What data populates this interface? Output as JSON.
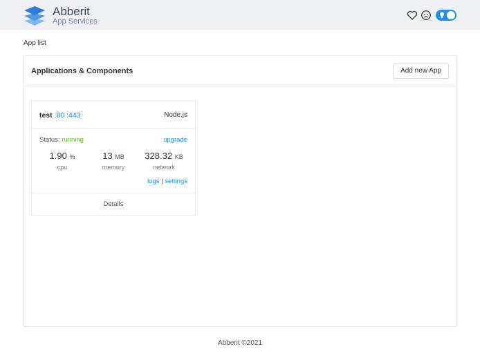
{
  "header": {
    "brand_name": "Abberit",
    "brand_sub": "App Services",
    "colors": {
      "accent": "#1f8ff0",
      "header_bg": "#eef0f4"
    },
    "icons": [
      "logo-stack-icon",
      "heart-icon",
      "frown-face-icon",
      "theme-toggle"
    ]
  },
  "breadcrumb": "App list",
  "panel": {
    "title": "Applications & Components",
    "add_button": "Add new App"
  },
  "apps": [
    {
      "name": "test",
      "ports": ":80 :443",
      "runtime": "Node.js",
      "status_label": "Status: ",
      "status": "running",
      "upgrade": "upgrade",
      "cpu": {
        "value": "1.90",
        "unit": "%",
        "label": "cpu"
      },
      "memory": {
        "value": "13",
        "unit": "MB",
        "label": "memory"
      },
      "network": {
        "value": "328.32",
        "unit": "KB",
        "label": "network"
      },
      "logs": "logs",
      "separator": "|",
      "settings": "settings",
      "details": "Details"
    }
  ],
  "footer": "Abberit ©2021"
}
